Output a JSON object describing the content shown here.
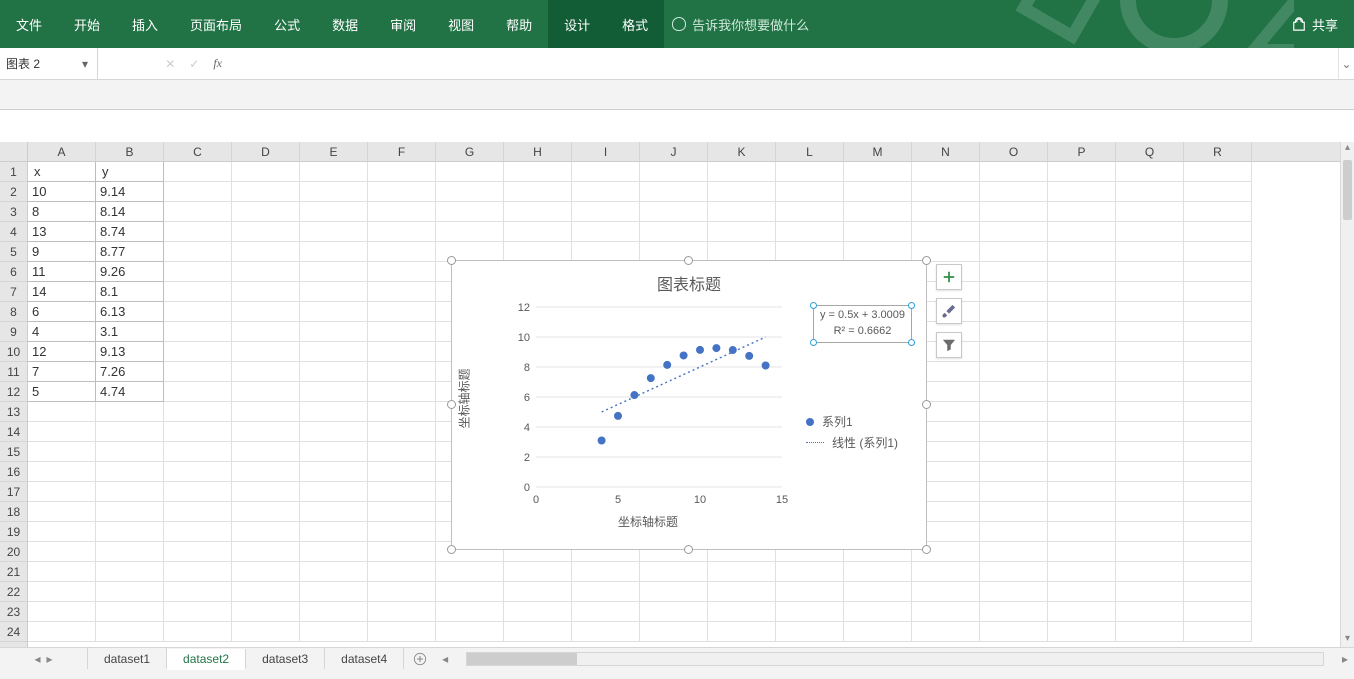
{
  "ribbon": {
    "tabs": [
      "文件",
      "开始",
      "插入",
      "页面布局",
      "公式",
      "数据",
      "审阅",
      "视图",
      "帮助"
    ],
    "context_tabs": [
      "设计",
      "格式"
    ],
    "tell_me_placeholder": "告诉我你想要做什么",
    "share_label": "共享"
  },
  "name_box": {
    "value": "图表 2"
  },
  "formula_bar": {
    "value": ""
  },
  "sheet": {
    "columns": [
      "A",
      "B",
      "C",
      "D",
      "E",
      "F",
      "G",
      "H",
      "I",
      "J",
      "K",
      "L",
      "M",
      "N",
      "O",
      "P",
      "Q",
      "R"
    ],
    "visible_rows": 24,
    "data": [
      [
        "x",
        "y"
      ],
      [
        "10",
        "9.14"
      ],
      [
        "8",
        "8.14"
      ],
      [
        "13",
        "8.74"
      ],
      [
        "9",
        "8.77"
      ],
      [
        "11",
        "9.26"
      ],
      [
        "14",
        "8.1"
      ],
      [
        "6",
        "6.13"
      ],
      [
        "4",
        "3.1"
      ],
      [
        "12",
        "9.13"
      ],
      [
        "7",
        "7.26"
      ],
      [
        "5",
        "4.74"
      ]
    ]
  },
  "sheet_tabs": {
    "tabs": [
      "dataset1",
      "dataset2",
      "dataset3",
      "dataset4"
    ],
    "active_index": 1
  },
  "chart": {
    "title": "图表标题",
    "x_axis_title": "坐标轴标题",
    "y_axis_title": "坐标轴标题",
    "legend_series": "系列1",
    "legend_trend": "线性 (系列1)",
    "equation_line1": "y = 0.5x + 3.0009",
    "equation_line2": "R² = 0.6662",
    "accent": "#4472C4"
  },
  "chart_data": {
    "type": "scatter",
    "title": "图表标题",
    "xlabel": "坐标轴标题",
    "ylabel": "坐标轴标题",
    "xlim": [
      0,
      15
    ],
    "ylim": [
      0,
      12
    ],
    "x_ticks": [
      0,
      5,
      10,
      15
    ],
    "y_ticks": [
      0,
      2,
      4,
      6,
      8,
      10,
      12
    ],
    "series": [
      {
        "name": "系列1",
        "x": [
          10,
          8,
          13,
          9,
          11,
          14,
          6,
          4,
          12,
          7,
          5
        ],
        "y": [
          9.14,
          8.14,
          8.74,
          8.77,
          9.26,
          8.1,
          6.13,
          3.1,
          9.13,
          7.26,
          4.74
        ]
      }
    ],
    "trendline": {
      "name": "线性 (系列1)",
      "slope": 0.5,
      "intercept": 3.0009,
      "r2": 0.6662,
      "style": "dotted"
    }
  }
}
